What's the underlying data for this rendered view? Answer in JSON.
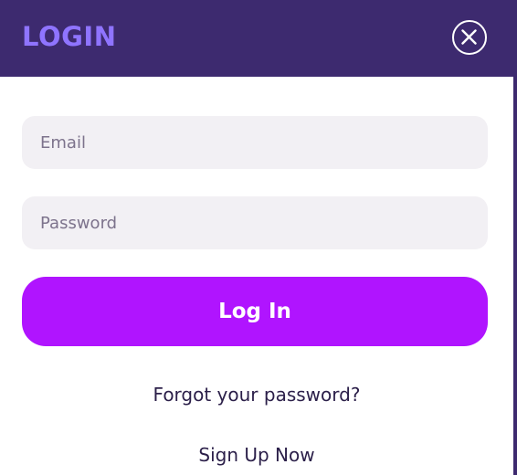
{
  "header": {
    "title": "LOGIN",
    "close_icon": "close-icon"
  },
  "form": {
    "email_placeholder": "Email",
    "email_value": "",
    "password_placeholder": "Password",
    "password_value": "",
    "submit_label": "Log In"
  },
  "links": {
    "forgot_password": "Forgot your password?",
    "sign_up": "Sign Up Now"
  },
  "colors": {
    "header_bg": "#3d2a6f",
    "title_accent": "#8f74ff",
    "button_bg": "#b014ff",
    "field_bg": "#f2f0f4",
    "text": "#2b1f49"
  }
}
